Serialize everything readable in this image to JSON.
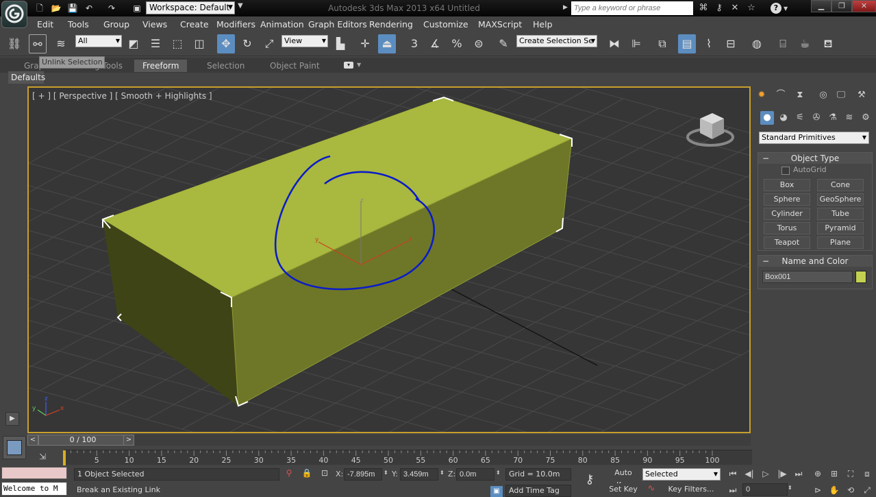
{
  "titlebar": {
    "workspace": "Workspace: Default",
    "app_title": "Autodesk 3ds Max  2013 x64      Untitled",
    "search_placeholder": "Type a keyword or phrase"
  },
  "menu": {
    "items": [
      "Edit",
      "Tools",
      "Group",
      "Views",
      "Create",
      "Modifiers",
      "Animation",
      "Graph Editors",
      "Rendering",
      "Customize",
      "MAXScript",
      "Help"
    ]
  },
  "toolbar": {
    "selection_filter": "All",
    "ref_coord": "View",
    "named_selection": "Create Selection Se",
    "tooltip": "Unlink Selection",
    "snap_angle_label": "3",
    "percent_snap_label": "%"
  },
  "ribbon": {
    "tabs": [
      "Graphite Modeling Tools",
      "Freeform",
      "Selection",
      "Object Paint"
    ],
    "active": "Freeform",
    "defaults_label": "Defaults"
  },
  "viewport": {
    "label": "[ + ] [ Perspective ]  [ Smooth + Highlights ]",
    "axis_x": "x",
    "axis_y": "y",
    "axis_z": "z",
    "gizmo_x": "x",
    "gizmo_y": "y",
    "gizmo_z": "z",
    "box_color": "#c3d150",
    "border_color": "#c8a02b",
    "annotation_color": "#0b1cc8"
  },
  "command_panel": {
    "primitives_dropdown": "Standard Primitives",
    "object_type": {
      "header": "Object Type",
      "autogrid": "AutoGrid",
      "buttons": [
        "Box",
        "Cone",
        "Sphere",
        "GeoSphere",
        "Cylinder",
        "Tube",
        "Torus",
        "Pyramid",
        "Teapot",
        "Plane"
      ]
    },
    "name_color": {
      "header": "Name and Color",
      "object_name": "Box001",
      "color": "#c3d150"
    }
  },
  "timeline": {
    "frame_display": "0 / 100",
    "ticks": [
      "0",
      "5",
      "10",
      "15",
      "20",
      "25",
      "30",
      "35",
      "40",
      "45",
      "50",
      "55",
      "60",
      "65",
      "70",
      "75",
      "80",
      "85",
      "90",
      "95",
      "100"
    ]
  },
  "status": {
    "maxscript_listener": "Welcome to M",
    "selection_status": "1 Object Selected",
    "prompt": "Break an Existing Link",
    "x_label": "X:",
    "x_value": "-7.895m",
    "y_label": "Y:",
    "y_value": "3.459m",
    "z_label": "Z:",
    "z_value": "0.0m",
    "grid": "Grid = 10.0m",
    "add_time_tag": "Add Time Tag",
    "auto_key": "Auto Key",
    "set_key": "Set Key",
    "selected_dropdown": "Selected",
    "key_filters": "Key Filters...",
    "frame_field": "0"
  }
}
